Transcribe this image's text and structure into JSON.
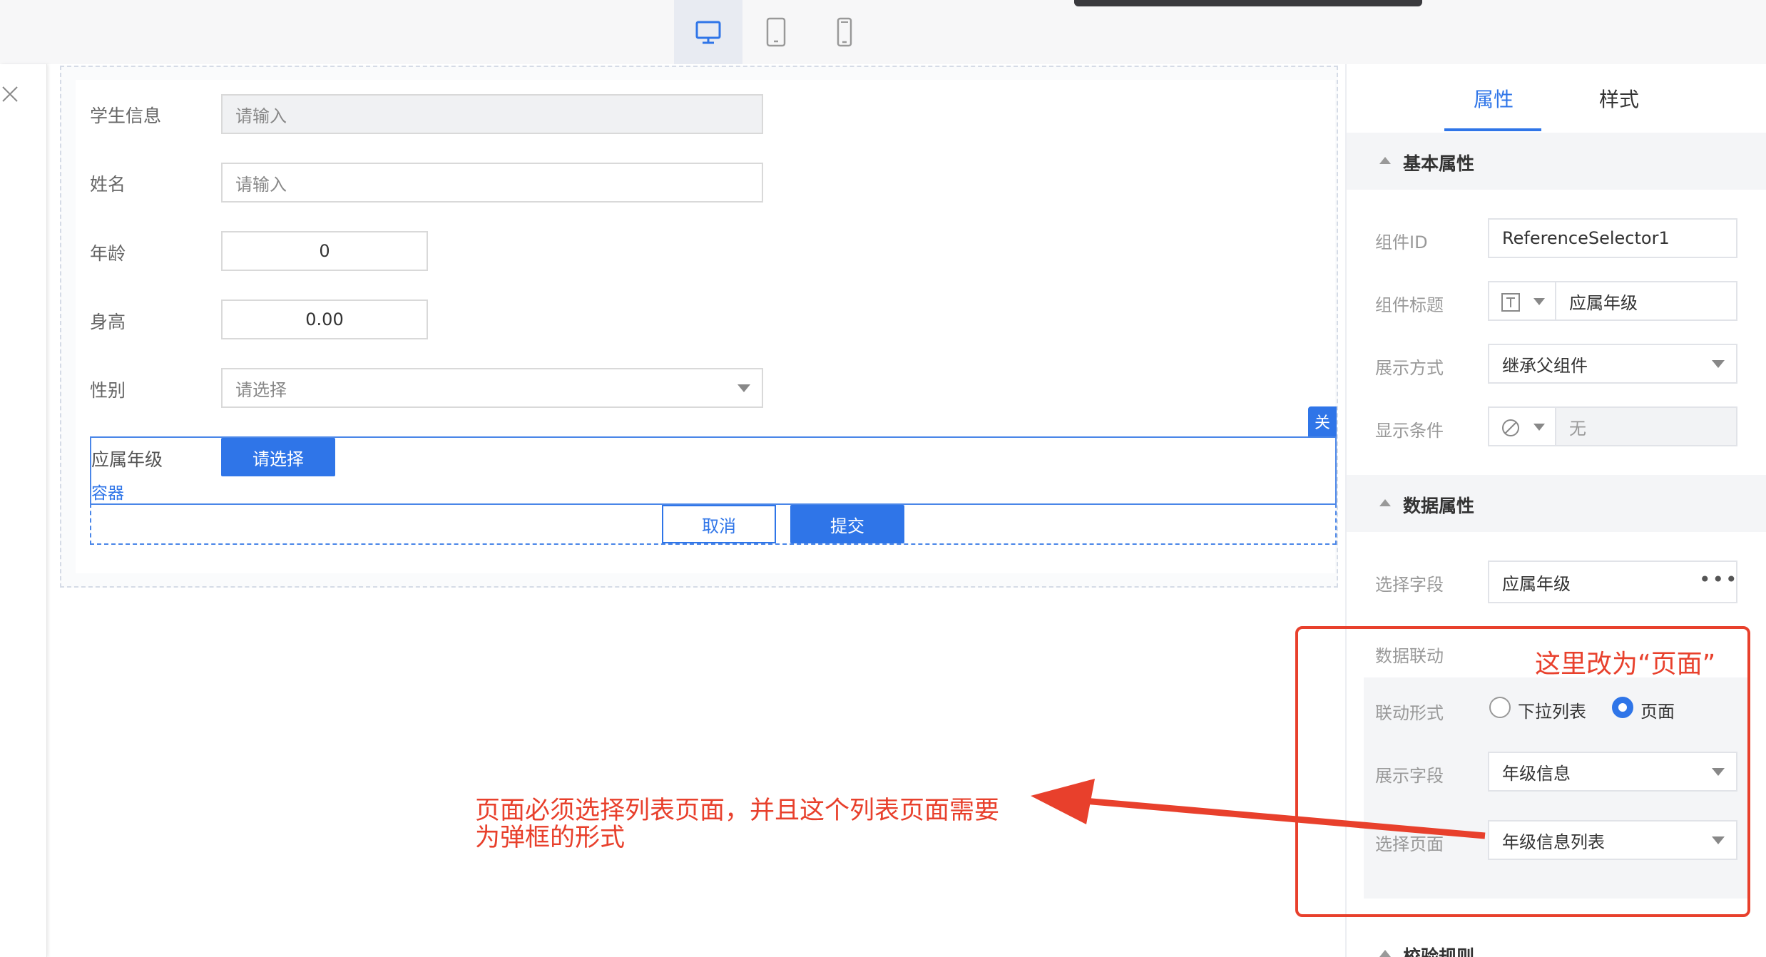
{
  "form": {
    "rows": [
      {
        "label": "学生信息",
        "placeholder": "请输入"
      },
      {
        "label": "姓名",
        "placeholder": "请输入"
      },
      {
        "label": "年龄",
        "value": "0"
      },
      {
        "label": "身高",
        "value": "0.00"
      },
      {
        "label": "性别",
        "placeholder": "请选择"
      }
    ],
    "grade_label": "应属年级",
    "grade_button": "请选择",
    "container_label": "容器",
    "close_tag": "关",
    "cancel_button": "取消",
    "submit_button": "提交"
  },
  "panel": {
    "tabs": [
      "属性",
      "样式"
    ],
    "basic_title": "基本属性",
    "component_id_label": "组件ID",
    "component_id_value": "ReferenceSelector1",
    "title_label": "组件标题",
    "title_value": "应属年级",
    "display_mode_label": "展示方式",
    "display_mode_value": "继承父组件",
    "display_cond_label": "显示条件",
    "display_cond_value": "无",
    "data_title": "数据属性",
    "select_field_label": "选择字段",
    "select_field_value": "应属年级",
    "linkage_label": "数据联动",
    "linkage_type_label": "联动形式",
    "linkage_options": [
      "下拉列表",
      "页面"
    ],
    "display_field_label": "展示字段",
    "display_field_value": "年级信息",
    "select_page_label": "选择页面",
    "select_page_value": "年级信息列表",
    "validation_title": "校验规则"
  },
  "annotations": {
    "note_top": "这里改为“页面”",
    "note_line1": "页面必须选择列表页面，并且这个列表页面需要",
    "note_line2": "为弹框的形式"
  },
  "colors": {
    "accent": "#2f75e8",
    "annotation": "#e8402c"
  }
}
